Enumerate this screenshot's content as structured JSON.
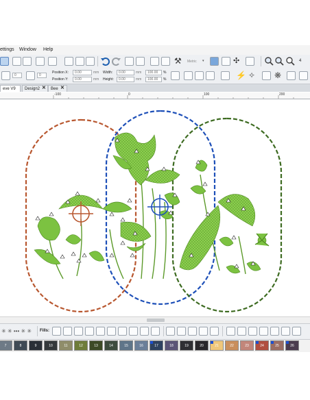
{
  "menu": {
    "items": [
      "ettings",
      "Window",
      "Help"
    ]
  },
  "toolbar": {
    "units_label": "Metric",
    "zoom_partial": "4"
  },
  "properties": {
    "position_x_label": "Position X:",
    "position_x_value": "0.00",
    "position_y_label": "Position Y:",
    "position_y_value": "0.00",
    "width_label": "Width:",
    "width_value": "0.00",
    "height_label": "Height:",
    "height_value": "0.00",
    "unit": "mm",
    "scale_w": "100.00",
    "scale_h": "100.00",
    "percent": "%",
    "stitch_field_1": "0",
    "stitch_field_2": "0"
  },
  "tabs": [
    {
      "label": "eve V9",
      "active": true
    },
    {
      "label": "Design2",
      "active": false
    },
    {
      "label": "Bee",
      "active": false
    }
  ],
  "tab_close_glyph": "✕",
  "ruler": {
    "ticks": [
      "-100",
      "0",
      "100",
      "200"
    ]
  },
  "canvas": {
    "hoop_colors": {
      "orange": "#b8572f",
      "blue": "#1d4fb8",
      "green": "#3d6b21"
    },
    "leaf_color": "#7cc241"
  },
  "fills": {
    "label": "Fills:",
    "left_glyphs": "✳ ✳ ••• ✳ ✳"
  },
  "palette": {
    "colors": [
      {
        "num": "7",
        "color": "#6e7a86",
        "marked": false
      },
      {
        "num": "8",
        "color": "#3f4a55",
        "marked": false
      },
      {
        "num": "9",
        "color": "#2a2f36",
        "marked": false
      },
      {
        "num": "10",
        "color": "#34383b",
        "marked": false
      },
      {
        "num": "11",
        "color": "#8f8d6a",
        "marked": false
      },
      {
        "num": "12",
        "color": "#6e7c3a",
        "marked": false
      },
      {
        "num": "13",
        "color": "#3d4a26",
        "marked": false
      },
      {
        "num": "14",
        "color": "#3e4c3e",
        "marked": false
      },
      {
        "num": "15",
        "color": "#5f7589",
        "marked": false
      },
      {
        "num": "16",
        "color": "#6b7f99",
        "marked": false
      },
      {
        "num": "17",
        "color": "#2f4260",
        "marked": true
      },
      {
        "num": "18",
        "color": "#5b5476",
        "marked": false
      },
      {
        "num": "19",
        "color": "#2f2f33",
        "marked": false
      },
      {
        "num": "20",
        "color": "#29272b",
        "marked": false
      },
      {
        "num": "21",
        "color": "#efc77a",
        "marked": true
      },
      {
        "num": "22",
        "color": "#c98e5c",
        "marked": false
      },
      {
        "num": "23",
        "color": "#c2867a",
        "marked": false
      },
      {
        "num": "24",
        "color": "#b04f40",
        "marked": true
      },
      {
        "num": "25",
        "color": "#9b6e64",
        "marked": true
      },
      {
        "num": "26",
        "color": "#4a3c4e",
        "marked": true
      }
    ]
  }
}
